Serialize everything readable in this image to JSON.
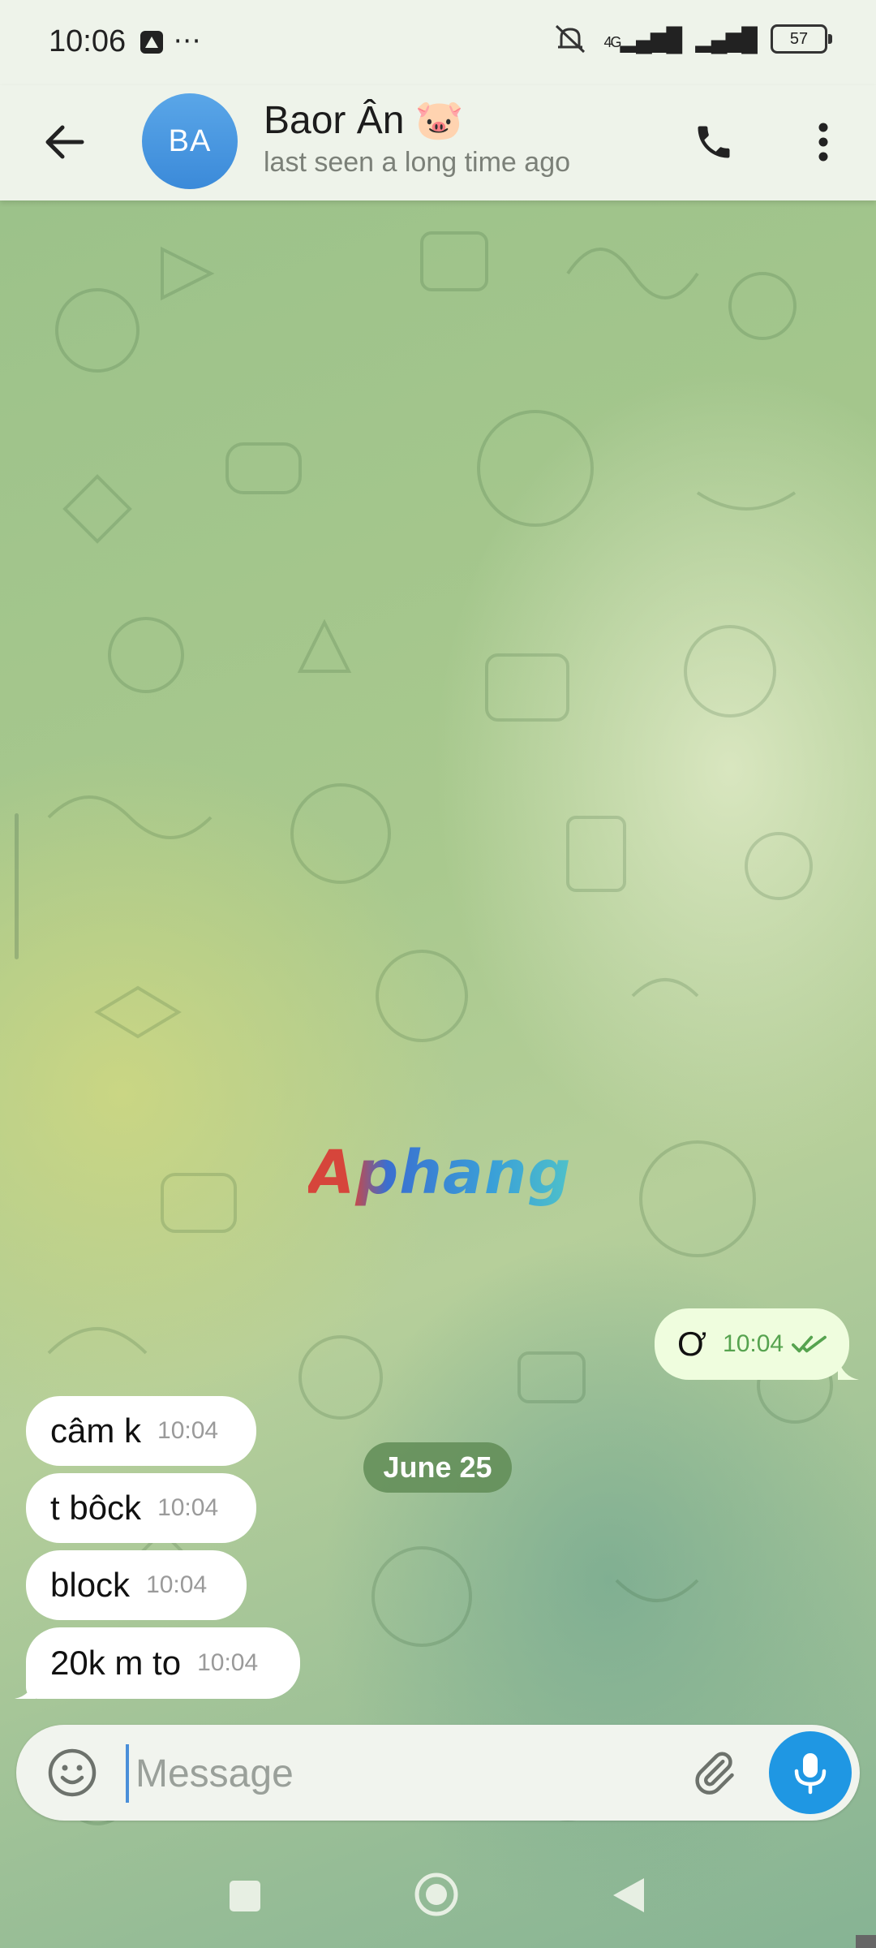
{
  "status_bar": {
    "time": "10:06",
    "left_icons": "⋯",
    "network": "4G",
    "battery": "57"
  },
  "header": {
    "avatar_initials": "BA",
    "contact_name": "Baor Ân 🐷",
    "contact_status": "last seen a long time ago"
  },
  "watermark": "Aphang",
  "chat": {
    "date_label": "June 25",
    "outgoing": [
      {
        "text": "Ơ",
        "time": "10:04",
        "read": true
      }
    ],
    "incoming": [
      {
        "text": "câm k",
        "time": "10:04"
      },
      {
        "text": "t bôck",
        "time": "10:04"
      },
      {
        "text": "block",
        "time": "10:04"
      },
      {
        "text": "20k m to",
        "time": "10:04"
      }
    ]
  },
  "composer": {
    "placeholder": "Message",
    "value": ""
  },
  "colors": {
    "accent": "#1f97e3",
    "avatar": "#4a98e0",
    "outgoing_bubble": "#effdde",
    "date_pill": "#6c9a5e",
    "read_checks": "#56a34f"
  },
  "icons": [
    "back-arrow-icon",
    "phone-icon",
    "more-vert-icon",
    "emoji-icon",
    "attach-icon",
    "mic-icon",
    "double-check-icon",
    "mute-icon",
    "nav-recents-icon",
    "nav-home-icon",
    "nav-back-icon"
  ]
}
